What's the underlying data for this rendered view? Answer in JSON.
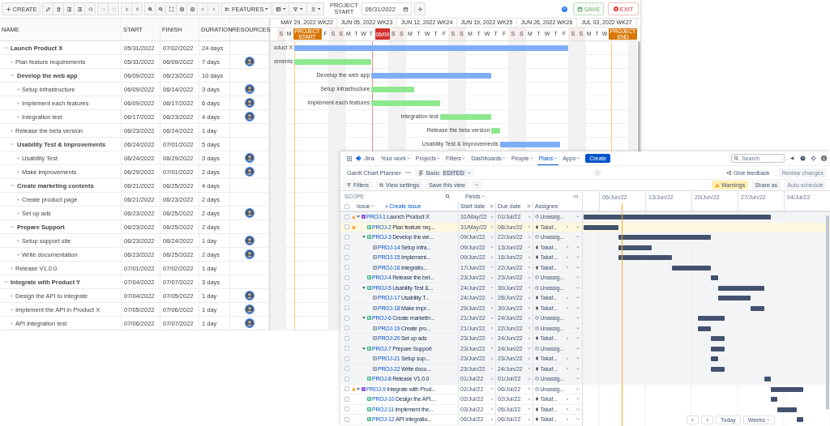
{
  "gantt": {
    "toolbar": {
      "create": "CREATE",
      "tool_groups": [
        {
          "tools": [
            {
              "kind": "edit",
              "disabled": false
            },
            {
              "kind": "delete",
              "disabled": false
            },
            {
              "kind": "indent",
              "disabled": false
            },
            {
              "kind": "outdent",
              "disabled": false
            },
            {
              "kind": "paint",
              "disabled": false
            }
          ]
        },
        {
          "tools": [
            {
              "kind": "undo",
              "disabled": true
            },
            {
              "kind": "redo",
              "disabled": true
            }
          ]
        },
        {
          "tools": [
            {
              "kind": "collapse",
              "disabled": false
            },
            {
              "kind": "expand",
              "disabled": false
            }
          ]
        },
        {
          "tools": [
            {
              "kind": "zoom-in",
              "disabled": false
            },
            {
              "kind": "zoom-out",
              "disabled": false
            },
            {
              "kind": "fit",
              "disabled": false
            },
            {
              "kind": "circle",
              "disabled": false
            },
            {
              "kind": "circle",
              "disabled": false
            },
            {
              "kind": "prev",
              "disabled": false
            },
            {
              "kind": "next",
              "disabled": false
            }
          ]
        }
      ],
      "dropdowns": [
        {
          "kind": "features",
          "label": "FEATURES"
        },
        {
          "kind": "columns"
        },
        {
          "kind": "filter"
        },
        {
          "kind": "person"
        }
      ],
      "project_start_label": "PROJECT START",
      "project_start": "05/31/2022",
      "save": {
        "label": "SAVE",
        "disabled": true
      },
      "exit": "EXIT"
    },
    "columns": [
      "NAME",
      "START",
      "FINISH",
      "DURATION",
      "RESOURCES"
    ],
    "tasks": [
      {
        "name": "Launch Product X",
        "start": "05/31/2022",
        "finish": "07/02/2022",
        "duration": "24 days",
        "resource": false,
        "expanded": true,
        "children": [
          {
            "name": "Plan feature requirements",
            "start": "05/31/2022",
            "finish": "06/09/2022",
            "duration": "7 days",
            "resource": true
          },
          {
            "name": "Develop the web app",
            "start": "06/09/2022",
            "finish": "06/23/2022",
            "duration": "10 days",
            "resource": false,
            "expanded": true,
            "children": [
              {
                "name": "Setup infrastructure",
                "start": "06/09/2022",
                "finish": "06/14/2022",
                "duration": "3 days",
                "resource": true
              },
              {
                "name": "Implement each features",
                "start": "06/09/2022",
                "finish": "06/17/2022",
                "duration": "6 days",
                "resource": true
              },
              {
                "name": "Integration test",
                "start": "06/17/2022",
                "finish": "06/23/2022",
                "duration": "4 days",
                "resource": true
              }
            ]
          },
          {
            "name": "Release the beta version",
            "start": "06/23/2022",
            "finish": "06/24/2022",
            "duration": "1 day",
            "resource": false
          },
          {
            "name": "Usability Test & Improvements",
            "start": "06/24/2022",
            "finish": "07/01/2022",
            "duration": "5 days",
            "resource": false,
            "expanded": true,
            "children": [
              {
                "name": "Usability Test",
                "start": "06/24/2022",
                "finish": "06/29/2022",
                "duration": "3 days",
                "resource": true
              },
              {
                "name": "Make improvements",
                "start": "06/29/2022",
                "finish": "07/01/2022",
                "duration": "2 days",
                "resource": true
              }
            ]
          },
          {
            "name": "Create marketing contents",
            "start": "06/21/2022",
            "finish": "06/25/2022",
            "duration": "4 days",
            "resource": false,
            "expanded": true,
            "children": [
              {
                "name": "Create product page",
                "start": "06/21/2022",
                "finish": "06/23/2022",
                "duration": "2 days",
                "resource": false
              },
              {
                "name": "Set up ads",
                "start": "06/23/2022",
                "finish": "06/25/2022",
                "duration": "2 days",
                "resource": true
              }
            ]
          },
          {
            "name": "Prepare Support",
            "start": "06/23/2022",
            "finish": "06/25/2022",
            "duration": "2 days",
            "resource": false,
            "expanded": true,
            "children": [
              {
                "name": "Setup support site",
                "start": "06/23/2022",
                "finish": "06/24/2022",
                "duration": "1 day",
                "resource": true
              },
              {
                "name": "Write documentation",
                "start": "06/23/2022",
                "finish": "06/25/2022",
                "duration": "2 days",
                "resource": true
              }
            ]
          },
          {
            "name": "Release V1.0.0",
            "start": "07/01/2022",
            "finish": "07/02/2022",
            "duration": "1 day",
            "resource": false
          }
        ]
      },
      {
        "name": "Integrate with Product Y",
        "start": "07/04/2022",
        "finish": "07/07/2022",
        "duration": "3 days",
        "resource": false,
        "expanded": true,
        "children": [
          {
            "name": "Design the API to integrate",
            "start": "07/04/2022",
            "finish": "07/05/2022",
            "duration": "1 day",
            "resource": true
          },
          {
            "name": "Implement the API in Product X",
            "start": "07/05/2022",
            "finish": "07/06/2022",
            "duration": "1 day",
            "resource": true
          },
          {
            "name": "API integration test",
            "start": "07/06/2022",
            "finish": "07/07/2022",
            "duration": "1 day",
            "resource": true
          }
        ]
      }
    ],
    "weeks": [
      {
        "label": "MAY 29, 2022 WK22",
        "days": [
          {
            "letter": "S"
          },
          {
            "letter": "M"
          },
          {
            "marker": "PROJECT START",
            "kind": "start"
          },
          {
            "letter": "F"
          },
          {
            "letter": "S"
          }
        ]
      },
      {
        "label": "JUN 05, 2022 WK23",
        "days": [
          {
            "letter": "S"
          },
          {
            "letter": "M"
          },
          {
            "letter": "T"
          },
          {
            "letter": "W"
          },
          {
            "letter": "T"
          },
          {
            "marker": "06/09",
            "kind": "today"
          },
          {
            "letter": "S"
          }
        ]
      },
      {
        "label": "JUN 12, 2022 WK24",
        "days": [
          {
            "letter": "S"
          },
          {
            "letter": "M"
          },
          {
            "letter": "T"
          },
          {
            "letter": "W"
          },
          {
            "letter": "T"
          },
          {
            "letter": "F"
          },
          {
            "letter": "S"
          }
        ]
      },
      {
        "label": "JUN 19, 2022 WK25",
        "days": [
          {
            "letter": "S"
          },
          {
            "letter": "M"
          },
          {
            "letter": "T"
          },
          {
            "letter": "W"
          },
          {
            "letter": "T"
          },
          {
            "letter": "F"
          },
          {
            "letter": "S"
          }
        ]
      },
      {
        "label": "JUN 26, 2022 WK26",
        "days": [
          {
            "letter": "S"
          },
          {
            "letter": "M"
          },
          {
            "letter": "T"
          },
          {
            "letter": "W"
          },
          {
            "letter": "T"
          },
          {
            "letter": "F"
          },
          {
            "letter": "S"
          }
        ]
      },
      {
        "label": "JUL 03, 2022 WK27",
        "days": [
          {
            "letter": "S"
          },
          {
            "letter": "M"
          },
          {
            "letter": "T"
          },
          {
            "letter": "W"
          },
          {
            "marker": "PROJECT END",
            "kind": "end"
          }
        ]
      }
    ],
    "bar_labels": [
      "oduct X",
      "ements",
      "Develop the web app",
      "Setup infrastructure",
      "Implement each features",
      "Integration test",
      "Release the beta version",
      "Usability Test & Improvements"
    ]
  },
  "jira": {
    "nav": {
      "product": "Jira",
      "items": [
        {
          "label": "Your work",
          "selected": false
        },
        {
          "label": "Projects",
          "selected": false
        },
        {
          "label": "Filters",
          "selected": false
        },
        {
          "label": "Dashboards",
          "selected": false
        },
        {
          "label": "People",
          "selected": false
        },
        {
          "label": "Plans",
          "selected": true
        },
        {
          "label": "Apps",
          "selected": false
        }
      ],
      "create": "Create",
      "search_placeholder": "Search"
    },
    "plan": {
      "title": "Gantt Chart Planner",
      "view": "Basic",
      "view_badge": "EDITED",
      "feedback": "Give feedback",
      "review": {
        "label": "Review changes",
        "disabled": true
      }
    },
    "toolbar": {
      "filters": "Filters",
      "view_settings": "View settings",
      "save_view": "Save this view",
      "warnings": "Warnings",
      "share": "Share as",
      "auto_schedule": {
        "label": "Auto-schedule",
        "disabled": true
      }
    },
    "scope": "SCOPE",
    "fields": "Fields",
    "select_all_checked": false,
    "columns": {
      "issue": "Issue",
      "create_issue": "Create issue",
      "start": "Start date",
      "due": "Due date",
      "assignee": "Assignee"
    },
    "timeline_dates": [
      "06/Jun/22",
      "13/Jun/22",
      "20/Jun/22",
      "27/Jun/22",
      "04/Jul/22"
    ],
    "issues": [
      {
        "kind": "epic",
        "key": "PROJ-1",
        "summary": "Launch Product X",
        "start": "31/May/22",
        "due": "01/Jul/22",
        "assignee": "Unassig...",
        "assigned": false,
        "warning": true,
        "checked": false,
        "expanded": true,
        "highlighted": false,
        "shaded": true,
        "children": [
          {
            "kind": "task",
            "key": "PROJ-2",
            "summary": "Plan feature req...",
            "start": "31/May/22",
            "due": "08/Jun/22",
            "assignee": "Takaf...",
            "assigned": true,
            "warning": true,
            "checked": false,
            "highlighted": true
          },
          {
            "kind": "task",
            "key": "PROJ-3",
            "summary": "Develop the we...",
            "start": "09/Jun/22",
            "due": "22/Jun/22",
            "assignee": "Unassig...",
            "assigned": false,
            "warning": false,
            "checked": false,
            "expanded": true,
            "highlighted": false,
            "children": [
              {
                "kind": "subtask",
                "key": "PROJ-14",
                "summary": "Setup infra...",
                "start": "09/Jun/22",
                "due": "13/Jun/22",
                "assignee": "Takaf...",
                "assigned": true,
                "warning": false,
                "checked": false,
                "highlighted": false
              },
              {
                "kind": "subtask",
                "key": "PROJ-15",
                "summary": "Implement...",
                "start": "09/Jun/22",
                "due": "16/Jun/22",
                "assignee": "Takaf...",
                "assigned": true,
                "warning": false,
                "checked": false,
                "highlighted": false
              },
              {
                "kind": "subtask",
                "key": "PROJ-16",
                "summary": "Integratio...",
                "start": "17/Jun/22",
                "due": "22/Jun/22",
                "assignee": "Takaf...",
                "assigned": true,
                "warning": false,
                "checked": false,
                "highlighted": false
              }
            ]
          },
          {
            "kind": "task",
            "key": "PROJ-4",
            "summary": "Release the bet...",
            "start": "23/Jun/22",
            "due": "23/Jun/22",
            "assignee": "Unassig...",
            "assigned": false,
            "warning": false,
            "checked": false,
            "highlighted": false
          },
          {
            "kind": "task",
            "key": "PROJ-5",
            "summary": "Usability Test &...",
            "start": "24/Jun/22",
            "due": "30/Jun/22",
            "assignee": "Unassig...",
            "assigned": false,
            "warning": false,
            "checked": false,
            "expanded": true,
            "highlighted": false,
            "children": [
              {
                "kind": "subtask",
                "key": "PROJ-17",
                "summary": "Usability T...",
                "start": "24/Jun/22",
                "due": "28/Jun/22",
                "assignee": "Takaf...",
                "assigned": true,
                "warning": false,
                "checked": false,
                "highlighted": false
              },
              {
                "kind": "subtask",
                "key": "PROJ-18",
                "summary": "Make impr...",
                "start": "29/Jun/22",
                "due": "30/Jun/22",
                "assignee": "Takaf...",
                "assigned": true,
                "warning": false,
                "checked": false,
                "highlighted": false
              }
            ]
          },
          {
            "kind": "task",
            "key": "PROJ-6",
            "summary": "Create marketin...",
            "start": "21/Jun/22",
            "due": "24/Jun/22",
            "assignee": "Unassig...",
            "assigned": false,
            "warning": false,
            "checked": false,
            "expanded": true,
            "highlighted": false,
            "children": [
              {
                "kind": "subtask",
                "key": "PROJ-19",
                "summary": "Create pro...",
                "start": "21/Jun/22",
                "due": "22/Jun/22",
                "assignee": "Unassig...",
                "assigned": false,
                "warning": false,
                "checked": false,
                "highlighted": false
              },
              {
                "kind": "subtask",
                "key": "PROJ-20",
                "summary": "Set up ads",
                "start": "23/Jun/22",
                "due": "24/Jun/22",
                "assignee": "Takaf...",
                "assigned": true,
                "warning": false,
                "checked": false,
                "highlighted": false
              }
            ]
          },
          {
            "kind": "task",
            "key": "PROJ-7",
            "summary": "Prepare Support",
            "start": "23/Jun/22",
            "due": "24/Jun/22",
            "assignee": "Unassig...",
            "assigned": false,
            "warning": false,
            "checked": false,
            "expanded": true,
            "highlighted": false,
            "children": [
              {
                "kind": "subtask",
                "key": "PROJ-21",
                "summary": "Setup sup...",
                "start": "23/Jun/22",
                "due": "23/Jun/22",
                "assignee": "Takaf...",
                "assigned": true,
                "warning": false,
                "checked": false,
                "highlighted": false
              },
              {
                "kind": "subtask",
                "key": "PROJ-22",
                "summary": "Write docu...",
                "start": "23/Jun/22",
                "due": "24/Jun/22",
                "assignee": "Takaf...",
                "assigned": true,
                "warning": false,
                "checked": false,
                "highlighted": false
              }
            ]
          },
          {
            "kind": "task",
            "key": "PROJ-8",
            "summary": "Release V1.0.0",
            "start": "01/Jul/22",
            "due": "01/Jul/22",
            "assignee": "Unassig...",
            "assigned": false,
            "warning": false,
            "checked": false,
            "highlighted": false
          }
        ]
      },
      {
        "kind": "epic",
        "key": "PROJ-9",
        "summary": "Integrate with Prod...",
        "start": "02/Jul/22",
        "due": "06/Jul/22",
        "assignee": "Unassig...",
        "assigned": false,
        "warning": true,
        "checked": false,
        "expanded": true,
        "highlighted": false,
        "shaded": false,
        "children": [
          {
            "kind": "task",
            "key": "PROJ-10",
            "summary": "Design the API...",
            "start": "02/Jul/22",
            "due": "02/Jul/22",
            "assignee": "Takaf...",
            "assigned": true,
            "warning": false,
            "checked": false,
            "highlighted": false
          },
          {
            "kind": "task",
            "key": "PROJ-11",
            "summary": "Implement the...",
            "start": "03/Jul/22",
            "due": "05/Jul/22",
            "assignee": "Takaf...",
            "assigned": true,
            "warning": false,
            "checked": false,
            "highlighted": false
          },
          {
            "kind": "task",
            "key": "PROJ-12",
            "summary": "API integratio...",
            "start": "06/Jul/22",
            "due": "06/Jul/22",
            "assignee": "Takaf...",
            "assigned": true,
            "warning": false,
            "checked": false,
            "highlighted": false
          }
        ]
      }
    ],
    "footer": {
      "today": "Today",
      "scale": "Weeks"
    }
  }
}
